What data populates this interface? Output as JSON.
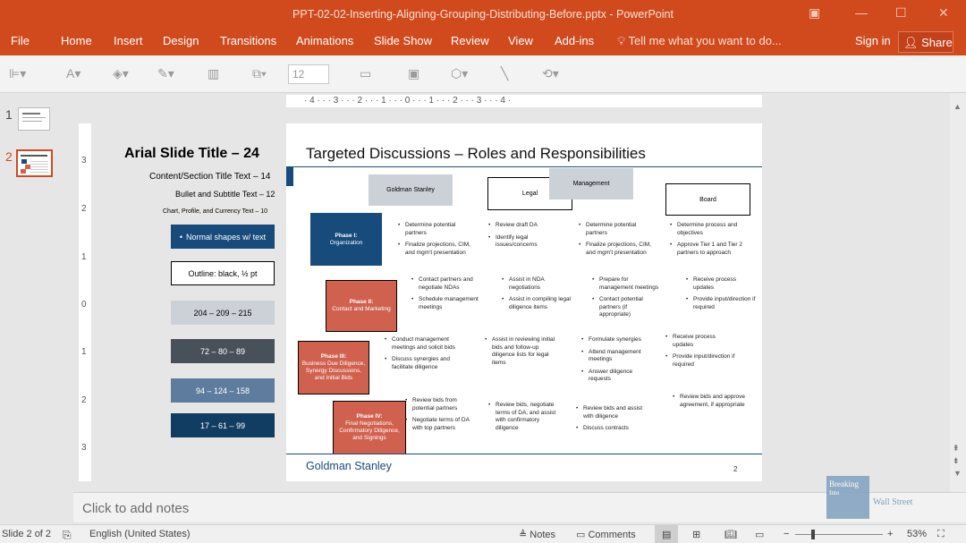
{
  "window": {
    "title": "PPT-02-02-Inserting-Aligning-Grouping-Distributing-Before.pptx - PowerPoint"
  },
  "menu": {
    "file": "File",
    "home": "Home",
    "insert": "Insert",
    "design": "Design",
    "transitions": "Transitions",
    "animations": "Animations",
    "slide_show": "Slide Show",
    "review": "Review",
    "view": "View",
    "addins": "Add-ins",
    "tell_me": "Tell me what you want to do...",
    "sign_in": "Sign in",
    "share": "Share"
  },
  "toolbar": {
    "font_size": "12"
  },
  "thumbnails": {
    "n1": "1",
    "n2": "2"
  },
  "ruler": {
    "h": "· 4 · · · 3 · · · 2 · · · 1 · · · 0 · · · 1 · · · 2 · · · 3 · · · 4 ·",
    "v": [
      "3",
      "2",
      "1",
      "0",
      "1",
      "2",
      "3"
    ]
  },
  "legend": {
    "title": "Arial Slide Title – 24",
    "content_title": "Content/Section Title Text – 14",
    "bullet_subtitle": "Bullet and Subtitle Text – 12",
    "chart_text": "Chart, Profile, and Currency Text – 10",
    "normal_shapes": "Normal shapes w/ text",
    "outline": "Outline: black, ½ pt",
    "c1": "204 – 209 – 215",
    "c2": "72 – 80 – 89",
    "c3": "94 – 124 – 158",
    "c4": "17 – 61 – 99"
  },
  "slide": {
    "title": "Targeted Discussions – Roles and Responsibilities",
    "headers": {
      "gs": "Goldman Stanley",
      "legal": "Legal",
      "management": "Management",
      "board": "Board"
    },
    "phases": {
      "p1_title": "Phase I:",
      "p1_sub": "Organization",
      "p2_title": "Phase II:",
      "p2_sub": "Contact and Marketing",
      "p3_title": "Phase III:",
      "p3_sub": "Business Due Diligence, Synergy Discussions, and Initial Bids",
      "p4_title": "Phase IV:",
      "p4_sub": "Final Negotiations, Confirmatory Diligence, and Signings"
    },
    "gs": {
      "p1a": "Determine potential partners",
      "p1b": "Finalize projections, CIM, and mgm't presentation",
      "p2a": "Contact partners and negotiate NDAs",
      "p2b": "Schedule management meetings",
      "p3a": "Conduct management meetings and solicit bids",
      "p3b": "Discuss synergies and facilitate diligence",
      "p4a": "Review bids from potential partners",
      "p4b": "Negotiate terms of DA with top partners"
    },
    "legal": {
      "p1a": "Review draft DA",
      "p1b": "Identify legal issues/concerns",
      "p2a": "Assist in NDA negotiations",
      "p2b": "Assist in compiling legal diligence items",
      "p3a": "Assist in reviewing initial bids and follow-up diligence lists for legal items",
      "p4a": "Review bids, negotiate terms of DA, and assist with confirmatory diligence"
    },
    "mgmt": {
      "p1a": "Determine potential partners",
      "p1b": "Finalize projections, CIM, and mgm't presentation",
      "p2a": "Prepare for management meetings",
      "p2b": "Contact potential partners (if appropriate)",
      "p3a": "Formulate synergies",
      "p3b": "Attend management meetings",
      "p3c": "Answer diligence requests",
      "p4a": "Review bids and assist with diligence",
      "p4b": "Discuss contracts"
    },
    "board": {
      "p1a": "Determine process and objectives",
      "p1b": "Approve Tier 1 and Tier 2 partners to approach",
      "p2a": "Receive process updates",
      "p2b": "Provide input/direction if required",
      "p3a": "Receive process updates",
      "p3b": "Provide input/direction if required",
      "p4a": "Review bids and approve agreement, if appropriate"
    },
    "footer": "Goldman Stanley",
    "page": "2"
  },
  "notes_placeholder": "Click to add notes",
  "status": {
    "slide": "Slide 2 of 2",
    "language": "English (United States)",
    "notes": "Notes",
    "comments": "Comments",
    "zoom": "53%"
  },
  "watermark": {
    "line1": "Breaking",
    "line2": "Into",
    "line3": "Wall Street"
  },
  "colors": {
    "accent": "#d04a1e",
    "navy": "#174b7c",
    "gray_light": "#ccd1d7",
    "gray_dark": "#485059",
    "blue_mid": "#5e7c9e",
    "blue_dark": "#113d63",
    "phase_red": "#d0614f"
  }
}
